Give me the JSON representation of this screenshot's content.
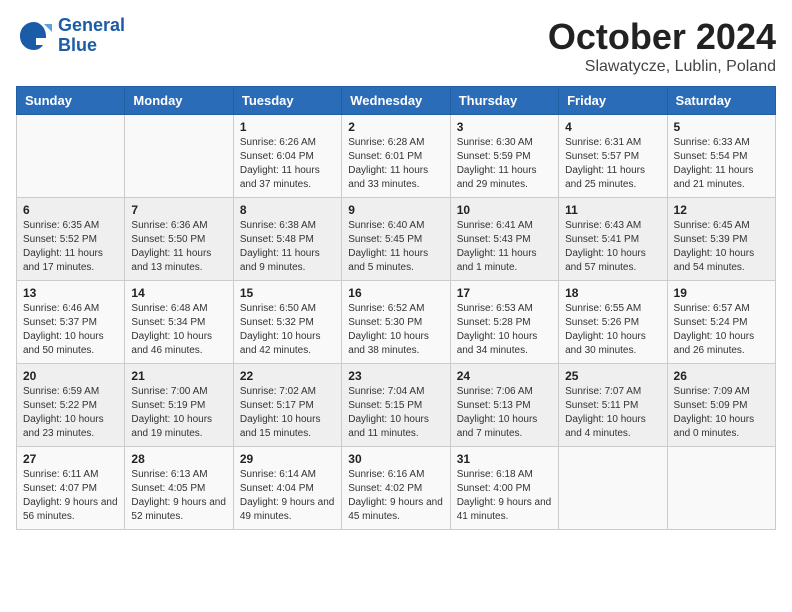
{
  "header": {
    "logo_line1": "General",
    "logo_line2": "Blue",
    "title": "October 2024",
    "subtitle": "Slawatycze, Lublin, Poland"
  },
  "days_of_week": [
    "Sunday",
    "Monday",
    "Tuesday",
    "Wednesday",
    "Thursday",
    "Friday",
    "Saturday"
  ],
  "weeks": [
    [
      {
        "day": "",
        "content": ""
      },
      {
        "day": "",
        "content": ""
      },
      {
        "day": "1",
        "content": "Sunrise: 6:26 AM\nSunset: 6:04 PM\nDaylight: 11 hours and 37 minutes."
      },
      {
        "day": "2",
        "content": "Sunrise: 6:28 AM\nSunset: 6:01 PM\nDaylight: 11 hours and 33 minutes."
      },
      {
        "day": "3",
        "content": "Sunrise: 6:30 AM\nSunset: 5:59 PM\nDaylight: 11 hours and 29 minutes."
      },
      {
        "day": "4",
        "content": "Sunrise: 6:31 AM\nSunset: 5:57 PM\nDaylight: 11 hours and 25 minutes."
      },
      {
        "day": "5",
        "content": "Sunrise: 6:33 AM\nSunset: 5:54 PM\nDaylight: 11 hours and 21 minutes."
      }
    ],
    [
      {
        "day": "6",
        "content": "Sunrise: 6:35 AM\nSunset: 5:52 PM\nDaylight: 11 hours and 17 minutes."
      },
      {
        "day": "7",
        "content": "Sunrise: 6:36 AM\nSunset: 5:50 PM\nDaylight: 11 hours and 13 minutes."
      },
      {
        "day": "8",
        "content": "Sunrise: 6:38 AM\nSunset: 5:48 PM\nDaylight: 11 hours and 9 minutes."
      },
      {
        "day": "9",
        "content": "Sunrise: 6:40 AM\nSunset: 5:45 PM\nDaylight: 11 hours and 5 minutes."
      },
      {
        "day": "10",
        "content": "Sunrise: 6:41 AM\nSunset: 5:43 PM\nDaylight: 11 hours and 1 minute."
      },
      {
        "day": "11",
        "content": "Sunrise: 6:43 AM\nSunset: 5:41 PM\nDaylight: 10 hours and 57 minutes."
      },
      {
        "day": "12",
        "content": "Sunrise: 6:45 AM\nSunset: 5:39 PM\nDaylight: 10 hours and 54 minutes."
      }
    ],
    [
      {
        "day": "13",
        "content": "Sunrise: 6:46 AM\nSunset: 5:37 PM\nDaylight: 10 hours and 50 minutes."
      },
      {
        "day": "14",
        "content": "Sunrise: 6:48 AM\nSunset: 5:34 PM\nDaylight: 10 hours and 46 minutes."
      },
      {
        "day": "15",
        "content": "Sunrise: 6:50 AM\nSunset: 5:32 PM\nDaylight: 10 hours and 42 minutes."
      },
      {
        "day": "16",
        "content": "Sunrise: 6:52 AM\nSunset: 5:30 PM\nDaylight: 10 hours and 38 minutes."
      },
      {
        "day": "17",
        "content": "Sunrise: 6:53 AM\nSunset: 5:28 PM\nDaylight: 10 hours and 34 minutes."
      },
      {
        "day": "18",
        "content": "Sunrise: 6:55 AM\nSunset: 5:26 PM\nDaylight: 10 hours and 30 minutes."
      },
      {
        "day": "19",
        "content": "Sunrise: 6:57 AM\nSunset: 5:24 PM\nDaylight: 10 hours and 26 minutes."
      }
    ],
    [
      {
        "day": "20",
        "content": "Sunrise: 6:59 AM\nSunset: 5:22 PM\nDaylight: 10 hours and 23 minutes."
      },
      {
        "day": "21",
        "content": "Sunrise: 7:00 AM\nSunset: 5:19 PM\nDaylight: 10 hours and 19 minutes."
      },
      {
        "day": "22",
        "content": "Sunrise: 7:02 AM\nSunset: 5:17 PM\nDaylight: 10 hours and 15 minutes."
      },
      {
        "day": "23",
        "content": "Sunrise: 7:04 AM\nSunset: 5:15 PM\nDaylight: 10 hours and 11 minutes."
      },
      {
        "day": "24",
        "content": "Sunrise: 7:06 AM\nSunset: 5:13 PM\nDaylight: 10 hours and 7 minutes."
      },
      {
        "day": "25",
        "content": "Sunrise: 7:07 AM\nSunset: 5:11 PM\nDaylight: 10 hours and 4 minutes."
      },
      {
        "day": "26",
        "content": "Sunrise: 7:09 AM\nSunset: 5:09 PM\nDaylight: 10 hours and 0 minutes."
      }
    ],
    [
      {
        "day": "27",
        "content": "Sunrise: 6:11 AM\nSunset: 4:07 PM\nDaylight: 9 hours and 56 minutes."
      },
      {
        "day": "28",
        "content": "Sunrise: 6:13 AM\nSunset: 4:05 PM\nDaylight: 9 hours and 52 minutes."
      },
      {
        "day": "29",
        "content": "Sunrise: 6:14 AM\nSunset: 4:04 PM\nDaylight: 9 hours and 49 minutes."
      },
      {
        "day": "30",
        "content": "Sunrise: 6:16 AM\nSunset: 4:02 PM\nDaylight: 9 hours and 45 minutes."
      },
      {
        "day": "31",
        "content": "Sunrise: 6:18 AM\nSunset: 4:00 PM\nDaylight: 9 hours and 41 minutes."
      },
      {
        "day": "",
        "content": ""
      },
      {
        "day": "",
        "content": ""
      }
    ]
  ]
}
